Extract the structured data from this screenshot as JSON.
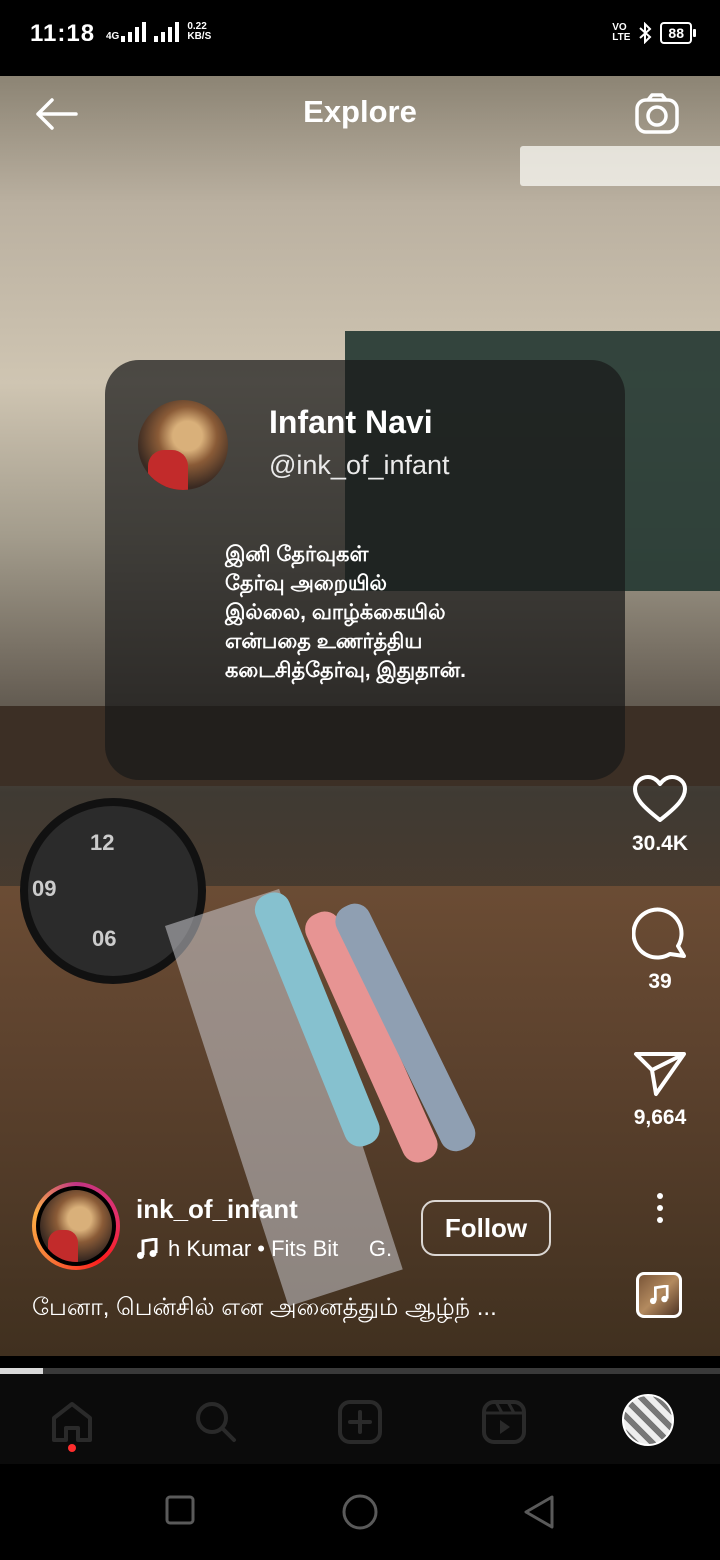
{
  "status_bar": {
    "time": "11:18",
    "network_type": "4G",
    "speed_value": "0.22",
    "speed_unit": "KB/S",
    "volte_line1": "VO",
    "volte_line2": "LTE",
    "battery": "88"
  },
  "header": {
    "title": "Explore",
    "back_icon": "arrow-left-icon",
    "camera_icon": "camera-icon"
  },
  "quote_card": {
    "name": "Infant Navi",
    "handle": "@ink_of_infant",
    "text": "இனி தேர்வுகள்\nதேர்வு அறையில்\nஇல்லை, வாழ்க்கையில்\nஎன்பதை உணர்த்திய\nகடைசித்தேர்வு, இதுதான்."
  },
  "actions": {
    "likes": "30.4K",
    "comments": "39",
    "shares": "9,664"
  },
  "post": {
    "username": "ink_of_infant",
    "audio_text": "h Kumar • Fits Bit     G.",
    "follow_label": "Follow",
    "caption": "பேனா, பென்சில் என அனைத்தும் ஆழ்ந் ..."
  },
  "progress": {
    "fraction": 0.06
  },
  "bottom_nav": {
    "items": [
      "home-icon",
      "search-icon",
      "create-icon",
      "reels-icon",
      "profile-avatar"
    ],
    "active": "home-icon"
  },
  "system_nav": [
    "recents-button",
    "home-button",
    "back-button"
  ]
}
